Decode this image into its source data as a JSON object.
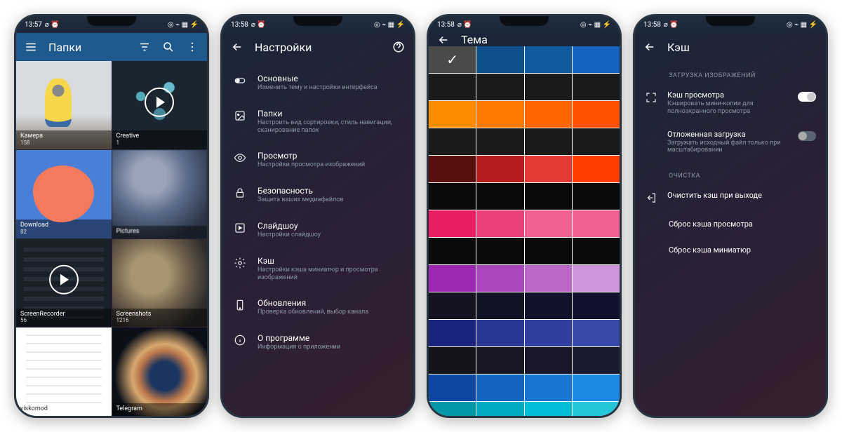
{
  "status": {
    "time1": "13:57",
    "time2": "13:58",
    "right_glyphs": "◎ ⌁ ▦ ⚡"
  },
  "p1": {
    "title": "Папки",
    "folders": [
      {
        "name": "Камера",
        "count": "158"
      },
      {
        "name": "Creative",
        "count": "1"
      },
      {
        "name": "Download",
        "count": "82"
      },
      {
        "name": "Pictures",
        "count": ""
      },
      {
        "name": "ScreenRecorder",
        "count": "56"
      },
      {
        "name": "Screenshots",
        "count": "1216"
      },
      {
        "name": "viskomod",
        "count": ""
      },
      {
        "name": "Telegram",
        "count": ""
      }
    ]
  },
  "p2": {
    "title": "Настройки",
    "items": [
      {
        "t": "Основные",
        "s": "Изменить тему и настройки интерфейса"
      },
      {
        "t": "Папки",
        "s": "Настроить вид сортировки, стиль навигации, сканирование папок"
      },
      {
        "t": "Просмотр",
        "s": "Настройки просмотра изображений"
      },
      {
        "t": "Безопасность",
        "s": "Защита ваших медиафайлов"
      },
      {
        "t": "Слайдшоу",
        "s": "Настройки слайдшоу"
      },
      {
        "t": "Кэш",
        "s": "Настройки кэша миниатюр и просмотра изображений"
      },
      {
        "t": "Обновления",
        "s": "Проверка обновлений, выбор канала"
      },
      {
        "t": "О программе",
        "s": "Информация о приложении"
      }
    ]
  },
  "p3": {
    "title": "Тема",
    "colors": [
      "#4a4a4a",
      "#0d4f8b",
      "#125a9e",
      "#1565c0",
      "#1a1a1a",
      "#1a1a1a",
      "#1a1a1a",
      "#1a1a1a",
      "#ff8c00",
      "#ff7900",
      "#ff6600",
      "#ff5200",
      "#1a1a1a",
      "#1a1a1a",
      "#1a1a1a",
      "#1a1a1a",
      "#5a0f0f",
      "#b71c1c",
      "#e53935",
      "#ff3d00",
      "#0a0a0a",
      "#0a0a0a",
      "#0a0a0a",
      "#0a0a0a",
      "#e91e63",
      "#ec407a",
      "#f06292",
      "#f06292",
      "#0a0a0a",
      "#0a0a0a",
      "#0a0a0a",
      "#0a0a0a",
      "#9c27b0",
      "#ab47bc",
      "#ba68c8",
      "#ce93d8",
      "#121220",
      "#121225",
      "#12122a",
      "#12122f",
      "#1a237e",
      "#283593",
      "#303f9f",
      "#3949ab",
      "#14141e",
      "#161624",
      "#18182a",
      "#1a1a30",
      "#0d47a1",
      "#1565c0",
      "#1976d2",
      "#1e88e5",
      "#0097a7",
      "#00acc1",
      "#00bcd4",
      "#26c6da"
    ],
    "selected_index": 0
  },
  "p4": {
    "title": "Кэш",
    "section1": "ЗАГРУЗКА ИЗОБРАЖЕНИЙ",
    "i1": {
      "t": "Кэш просмотра",
      "s": "Кэшировать мини-копии для полноэкранного просмотра"
    },
    "i2": {
      "t": "Отложенная загрузка",
      "s": "Загружать исходный файл только при масштабировании"
    },
    "section2": "ОЧИСТКА",
    "i3": "Очистить кэш при выходе",
    "i4": "Сброс кэша просмотра",
    "i5": "Сброс кэша миниатюр"
  }
}
